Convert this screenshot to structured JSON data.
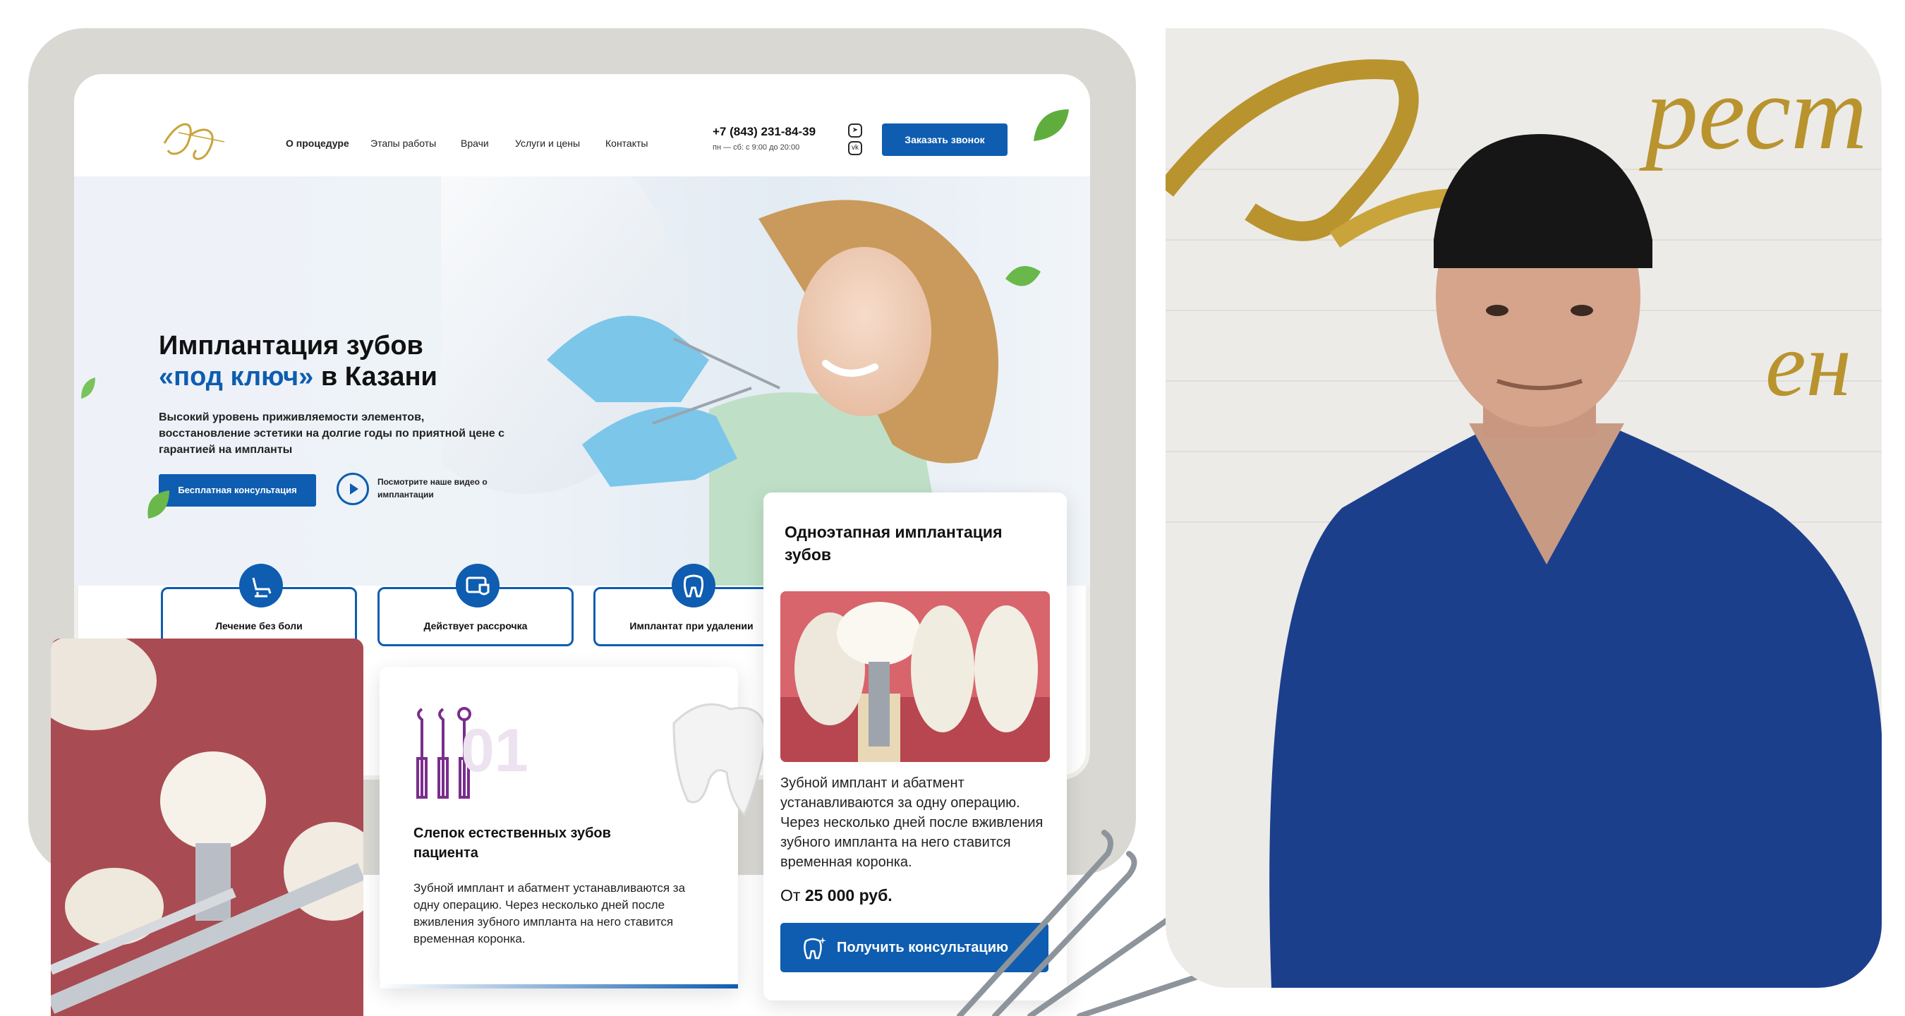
{
  "header": {
    "nav": [
      "О процедуре",
      "Этапы работы",
      "Врачи",
      "Услуги и цены",
      "Контакты"
    ],
    "phone": "+7 (843) 231-84-39",
    "hours": "пн — сб: с 9:00 до 20:00",
    "call_button": "Заказать звонок"
  },
  "hero": {
    "title_line1": "Имплантация зубов",
    "title_accent": "«под ключ»",
    "title_rest": " в Казани",
    "lead": "Высокий уровень приживляемости элементов, восстановление эстетики на долгие годы по приятной цене с гарантией на импланты",
    "cta_button": "Бесплатная консультация",
    "video_link": "Посмотрите наше видео о имплантации"
  },
  "features": [
    "Лечение без боли",
    "Действует рассрочка",
    "Имплантат при удалении"
  ],
  "price_card": {
    "title": "Одноэтапная имплантация зубов",
    "text": "Зубной имплант и абатмент устанавливаются за одну операцию. Через несколько дней после вживления зубного импланта на него ставится временная коронка.",
    "price_prefix": "От ",
    "price": "25 000 руб.",
    "button": "Получить консультацию"
  },
  "step_card": {
    "number": "01",
    "title": "Слепок естественных зубов пациента",
    "text": "Зубной имплант и абатмент устанавливаются за одну операцию. Через несколько дней после вживления зубного импланта на него ставится временная коронка."
  },
  "colors": {
    "brand_blue": "#0e5db0",
    "accent_purple": "#7a2e8c",
    "scrubs_blue": "#1c3f8c",
    "gold": "#b9932e"
  }
}
